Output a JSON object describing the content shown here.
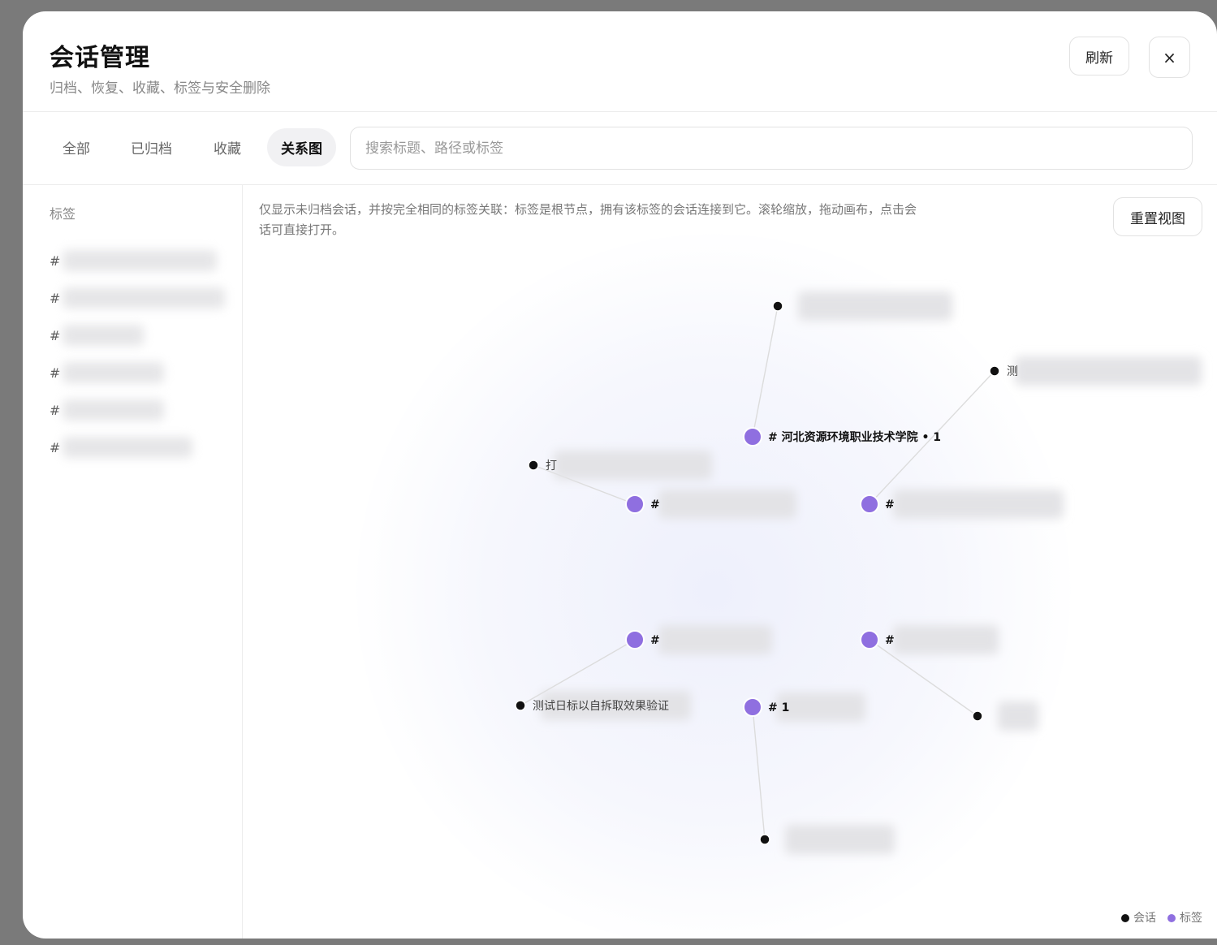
{
  "header": {
    "title": "会话管理",
    "subtitle": "归档、恢复、收藏、标签与安全删除",
    "refresh_label": "刷新",
    "close_label": "×"
  },
  "toolbar": {
    "tabs": [
      {
        "label": "全部",
        "active": false
      },
      {
        "label": "已归档",
        "active": false
      },
      {
        "label": "收藏",
        "active": false
      },
      {
        "label": "关系图",
        "active": true
      }
    ],
    "search_placeholder": "搜索标题、路径或标签"
  },
  "sidebar": {
    "heading": "标签",
    "items": [
      {
        "hash": "#",
        "label": "",
        "blurred": true
      },
      {
        "hash": "#",
        "label": "",
        "blurred": true
      },
      {
        "hash": "#",
        "label": "",
        "blurred": true
      },
      {
        "hash": "#",
        "label": "",
        "blurred": true
      },
      {
        "hash": "#",
        "label": "",
        "blurred": true
      },
      {
        "hash": "#",
        "label": "",
        "blurred": true
      }
    ]
  },
  "graph": {
    "hint": "仅显示未归档会话，并按完全相同的标签关联：标签是根节点，拥有该标签的会话连接到它。滚轮缩放，拖动画布，点击会话可直接打开。",
    "reset_label": "重置视图",
    "legend": {
      "session": "会话",
      "tag": "标签"
    },
    "colors": {
      "session": "#111111",
      "tag": "#8f6fe0",
      "edge": "#dcdcdc"
    },
    "tag_nodes": [
      {
        "id": "t1",
        "label": "# 河北资源环境职业技术学院 • 1",
        "blurred": false
      },
      {
        "id": "t2",
        "label": "#",
        "blurred": true
      },
      {
        "id": "t3",
        "label": "#",
        "blurred": true
      },
      {
        "id": "t4",
        "label": "#",
        "blurred": true
      },
      {
        "id": "t5",
        "label": "#",
        "blurred": true
      },
      {
        "id": "t6",
        "label": "# 1",
        "blurred": true
      }
    ],
    "session_nodes": [
      {
        "id": "s1",
        "label": "",
        "blurred": true
      },
      {
        "id": "s2",
        "label": "测",
        "blurred": true
      },
      {
        "id": "s3",
        "label": "打",
        "blurred": true
      },
      {
        "id": "s4",
        "label": "测试日标以自拆取效果验证",
        "blurred": true
      },
      {
        "id": "s5",
        "label": "",
        "blurred": true
      },
      {
        "id": "s6",
        "label": "",
        "blurred": true
      }
    ],
    "edges": [
      [
        "t1",
        "s1"
      ],
      [
        "t3",
        "s2"
      ],
      [
        "t2",
        "s3"
      ],
      [
        "t4",
        "s4"
      ],
      [
        "t5",
        "s5"
      ],
      [
        "t6",
        "s6"
      ]
    ]
  }
}
